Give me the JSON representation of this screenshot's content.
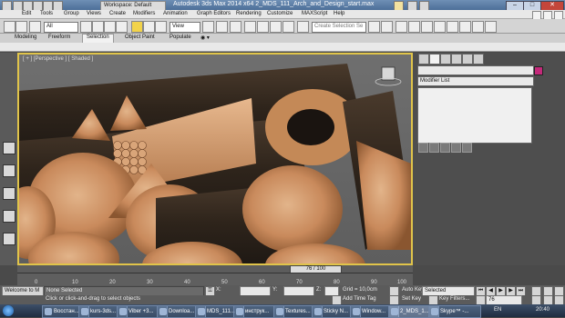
{
  "titlebar": {
    "workspace": "Workspace: Default",
    "title": "Autodesk 3ds Max  2014 x64     2_MDS_111_Arch_and_Design_start.max",
    "min": "–",
    "max": "□",
    "close": "✕"
  },
  "menu": {
    "items": [
      "Edit",
      "Tools",
      "Group",
      "Views",
      "Create",
      "Modifiers",
      "Animation",
      "Graph Editors",
      "Rendering",
      "Customize",
      "MAXScript",
      "Help"
    ]
  },
  "toolbar": {
    "selection_filter": "All",
    "ref_coord": "View",
    "named_selection_placeholder": "Create Selection Se"
  },
  "ribbon": {
    "tabs": [
      "Modeling",
      "Freeform",
      "Selection",
      "Object Paint",
      "Populate"
    ],
    "active_tab": "Selection"
  },
  "viewport": {
    "label": "[ + ] [Perspective ] [ Shaded ]"
  },
  "command_panel": {
    "name_field": "",
    "modifier_list": "Modifier List",
    "swatch_color": "#c4297a"
  },
  "timeline": {
    "frame_display": "76 / 100",
    "ticks": [
      "0",
      "10",
      "20",
      "30",
      "40",
      "50",
      "60",
      "70",
      "80",
      "90",
      "100"
    ]
  },
  "status": {
    "selection": "None Selected",
    "prompt": "Click or click-and-drag to select objects",
    "script_label": "Welcome to M",
    "x_label": "X:",
    "y_label": "Y:",
    "z_label": "Z:",
    "grid": "Grid = 10,0cm",
    "add_time_tag": "Add Time Tag",
    "auto_key": "Auto Key",
    "set_key": "Set Key",
    "selected_dropdown": "Selected",
    "key_filters": "Key Filters...",
    "current_frame": "76"
  },
  "taskbar": {
    "tasks": [
      "Восстан...",
      "kurs-3ds...",
      "Viber +3...",
      "Downloa...",
      "MDS_111...",
      "инструк...",
      "Textures...",
      "Sticky N...",
      "Window...",
      "2_MDS_1...",
      "Skype™ -..."
    ],
    "active_index": 9,
    "lang": "EN",
    "clock": "20:40"
  }
}
